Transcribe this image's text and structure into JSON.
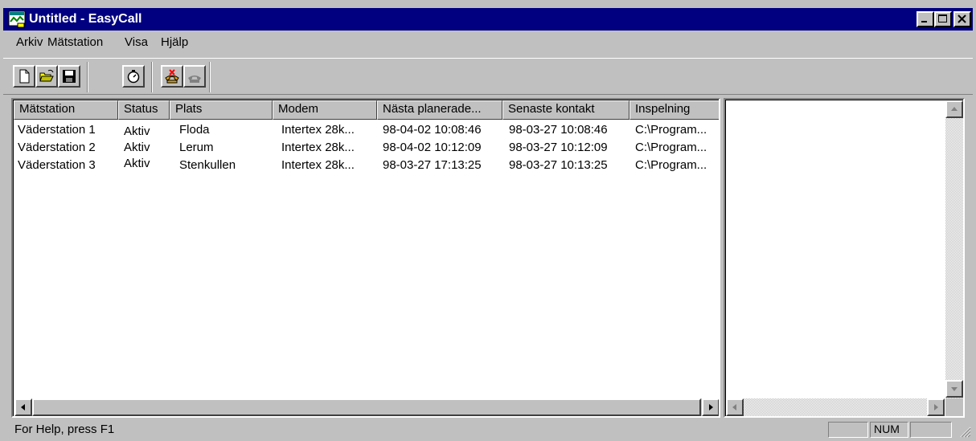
{
  "window": {
    "title": "Untitled - EasyCall"
  },
  "menu": [
    "Arkiv",
    "Mätstation",
    "Visa",
    "Hjälp"
  ],
  "toolbar": {
    "buttons": [
      "new-document-icon",
      "open-folder-icon",
      "save-disk-icon",
      "timer-icon",
      "hangup-phone-icon",
      "phone-icon"
    ]
  },
  "list": {
    "columns": [
      "Mätstation",
      "Status",
      "Plats",
      "Modem",
      "Nästa planerade...",
      "Senaste kontakt",
      "Inspelning"
    ],
    "rows": [
      [
        "Väderstation 1",
        "Aktiv",
        "Floda",
        "Intertex 28k...",
        "98-04-02 10:08:46",
        "98-03-27 10:08:46",
        "C:\\Program..."
      ],
      [
        "Väderstation 2",
        "Aktiv",
        "Lerum",
        "Intertex 28k...",
        "98-04-02 10:12:09",
        "98-03-27 10:12:09",
        "C:\\Program..."
      ],
      [
        "Väderstation 3",
        "Aktiv",
        "Stenkullen",
        "Intertex 28k...",
        "98-03-27 17:13:25",
        "98-03-27 10:13:25",
        "C:\\Program..."
      ]
    ]
  },
  "statusbar": {
    "help": "For Help, press F1",
    "num": "NUM"
  },
  "colors": {
    "title_bar": "#000080",
    "face": "#c0c0c0"
  }
}
